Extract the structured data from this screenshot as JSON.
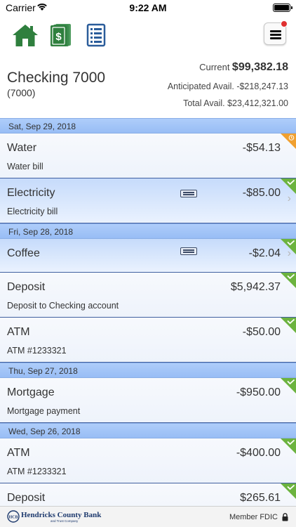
{
  "status_bar": {
    "carrier": "Carrier",
    "time": "9:22 AM"
  },
  "nav": {
    "icons": [
      "home-icon",
      "money-icon",
      "list-icon",
      "menu-icon"
    ],
    "brand_green": "#2f7f3e",
    "brand_blue": "#2a5c9a"
  },
  "account": {
    "name": "Checking 7000",
    "number": "(7000)",
    "current_label": "Current",
    "current_value": "$99,382.18",
    "anticipated_label": "Anticipated Avail.",
    "anticipated_value": "-$218,247.13",
    "total_label": "Total Avail.",
    "total_value": "$23,412,321.00"
  },
  "groups": [
    {
      "date": "Sat, Sep 29, 2018",
      "transactions": [
        {
          "name": "Water",
          "description": "Water bill",
          "amount": "-$54.13",
          "status": "pending"
        },
        {
          "name": "Electricity",
          "description": "Electricity bill",
          "amount": "-$85.00",
          "status": "cleared",
          "memo": true,
          "chevron": true,
          "selected": true
        }
      ]
    },
    {
      "date": "Fri, Sep 28, 2018",
      "transactions": [
        {
          "name": "Coffee",
          "description": "",
          "amount": "-$2.04",
          "status": "cleared",
          "memo": true,
          "chevron": true,
          "selected": true
        },
        {
          "name": "Deposit",
          "description": "Deposit to Checking account",
          "amount": "$5,942.37",
          "status": "cleared"
        },
        {
          "name": "ATM",
          "description": "ATM #1233321",
          "amount": "-$50.00",
          "status": "cleared"
        }
      ]
    },
    {
      "date": "Thu, Sep 27, 2018",
      "transactions": [
        {
          "name": "Mortgage",
          "description": "Mortgage payment",
          "amount": "-$950.00",
          "status": "cleared"
        }
      ]
    },
    {
      "date": "Wed, Sep 26, 2018",
      "transactions": [
        {
          "name": "ATM",
          "description": "ATM #1233321",
          "amount": "-$400.00",
          "status": "cleared"
        },
        {
          "name": "Deposit",
          "description": "",
          "amount": "$265.61",
          "status": "cleared"
        }
      ]
    }
  ],
  "footer": {
    "bank_name": "Hendricks County Bank",
    "bank_tagline": "and Trust Company",
    "fdic": "Member FDIC"
  },
  "colors": {
    "pending": "#f0a030",
    "cleared": "#6cb33f",
    "header_blue": "#a8c8f8",
    "row_divider": "#3f5f9f"
  }
}
